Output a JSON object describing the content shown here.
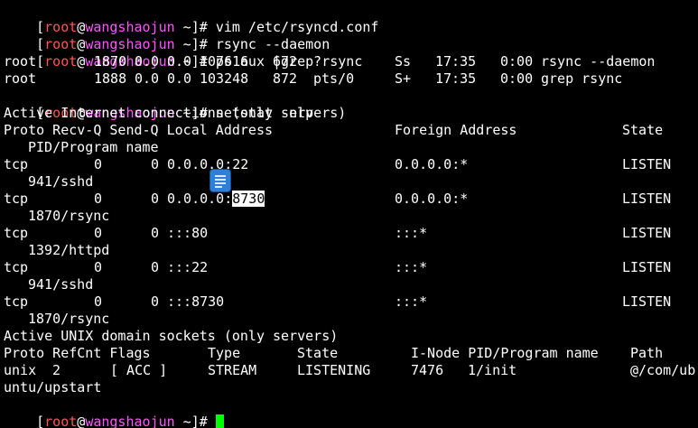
{
  "prompt": {
    "open_bracket": "[",
    "user": "root",
    "at": "@",
    "host": "wangshaojun",
    "path_tail": " ~]# "
  },
  "session": {
    "cmd1": "vim /etc/rsyncd.conf",
    "cmd2": "rsync --daemon",
    "cmd3": "ps aux |grep rsync",
    "ps_row1": {
      "user": "root",
      "pid": "1870",
      "cpu": "0.0",
      "mem": "0.0",
      "vsz": "107616",
      "rss": "672",
      "tty": "?",
      "stat": "Ss",
      "start": "17:35",
      "time": "0:00",
      "command": "rsync --daemon"
    },
    "ps_row2": {
      "user": "root",
      "pid": "1888",
      "cpu": "0.0",
      "mem": "0.0",
      "vsz": "103248",
      "rss": "872",
      "tty": "pts/0",
      "stat": "S+",
      "start": "17:35",
      "time": "0:00",
      "command": "grep rsync"
    },
    "cmd4": "netstat -nlp",
    "inet_heading": "Active Internet connections (only servers)",
    "inet_header_a": "Proto Recv-Q Send-Q Local Address",
    "inet_header_b": "Foreign Address",
    "inet_header_c": "State",
    "inet_header_cont": "PID/Program name",
    "inet_rows": [
      {
        "proto": "tcp",
        "recvq": "0",
        "sendq": "0",
        "local_prefix": "0.0.0.0:22",
        "local_highlight": "",
        "foreign": "0.0.0.0:*",
        "state": "LISTEN",
        "pid_prog": "941/sshd"
      },
      {
        "proto": "tcp",
        "recvq": "0",
        "sendq": "0",
        "local_prefix": "0.0.0.0:",
        "local_highlight": "8730",
        "foreign": "0.0.0.0:*",
        "state": "LISTEN",
        "pid_prog": "1870/rsync"
      },
      {
        "proto": "tcp",
        "recvq": "0",
        "sendq": "0",
        "local_prefix": ":::80",
        "local_highlight": "",
        "foreign": ":::*",
        "state": "LISTEN",
        "pid_prog": "1392/httpd"
      },
      {
        "proto": "tcp",
        "recvq": "0",
        "sendq": "0",
        "local_prefix": ":::22",
        "local_highlight": "",
        "foreign": ":::*",
        "state": "LISTEN",
        "pid_prog": "941/sshd"
      },
      {
        "proto": "tcp",
        "recvq": "0",
        "sendq": "0",
        "local_prefix": ":::8730",
        "local_highlight": "",
        "foreign": ":::*",
        "state": "LISTEN",
        "pid_prog": "1870/rsync"
      }
    ],
    "unix_heading": "Active UNIX domain sockets (only servers)",
    "unix_header": {
      "a": "Proto RefCnt Flags",
      "b": "Type",
      "c": "State",
      "d": "I-Node PID/Program name",
      "e": "Path"
    },
    "unix_row": {
      "proto": "unix",
      "refcnt": "2",
      "flags": "[ ACC ]",
      "type": "STREAM",
      "state": "LISTENING",
      "inode": "7476",
      "pid_prog": "1/init",
      "path": "@/com/ub",
      "path_wrap": "untu/upstart"
    }
  },
  "colors": {
    "background": "#000000",
    "text": "#ffffff",
    "user": "#ff5555",
    "host": "#ff55ff",
    "cursor": "#00ff00"
  },
  "overlay_icon": "document-icon"
}
